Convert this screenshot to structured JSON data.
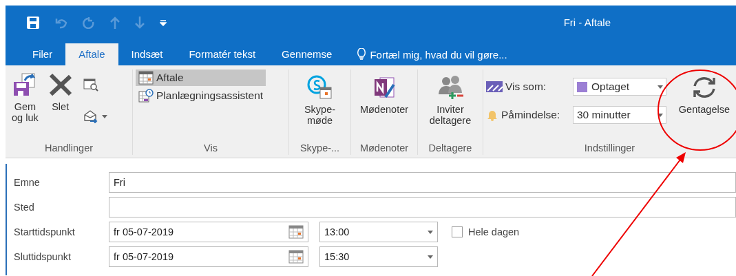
{
  "window": {
    "title": "Fri - Aftale"
  },
  "tabs": [
    {
      "label": "Filer",
      "selected": false
    },
    {
      "label": "Aftale",
      "selected": true
    },
    {
      "label": "Indsæt",
      "selected": false
    },
    {
      "label": "Formatér tekst",
      "selected": false
    },
    {
      "label": "Gennemse",
      "selected": false
    }
  ],
  "tell_me": {
    "placeholder": "Fortæl mig, hvad du vil gøre..."
  },
  "ribbon": {
    "groups": [
      {
        "label": "Handlinger",
        "kind": "actions",
        "buttons": [
          {
            "label": "Gem\nog luk",
            "kind": "save"
          },
          {
            "label": "Slet",
            "kind": "delete"
          }
        ]
      },
      {
        "label": "Vis",
        "kind": "views",
        "items": [
          {
            "label": "Aftale",
            "selected": true,
            "kind": "calendar"
          },
          {
            "label": "Planlægningsassistent",
            "selected": false,
            "kind": "scheduler"
          }
        ]
      },
      {
        "label": "Skype-...",
        "kind": "large",
        "buttons": [
          {
            "label": "Skype-\nmøde",
            "kind": "skype"
          }
        ]
      },
      {
        "label": "Mødenoter",
        "kind": "large",
        "buttons": [
          {
            "label": "Mødenoter",
            "kind": "notes"
          }
        ]
      },
      {
        "label": "Deltagere",
        "kind": "large",
        "buttons": [
          {
            "label": "Inviter\ndeltagere",
            "kind": "people"
          }
        ]
      },
      {
        "label": "Indstillinger",
        "kind": "options",
        "show_as": {
          "label": "Vis som:",
          "value": "Optaget",
          "color": "#9b7fd4"
        },
        "reminder": {
          "label": "Påmindelse:",
          "value": "30 minutter"
        },
        "buttons": [
          {
            "label": "Gentagelse",
            "kind": "recur"
          }
        ]
      }
    ]
  },
  "form": {
    "subject": {
      "label": "Emne",
      "value": "Fri"
    },
    "location": {
      "label": "Sted"
    },
    "start": {
      "label": "Starttidspunkt",
      "date": "fr 05-07-2019",
      "time": "13:00"
    },
    "end": {
      "label": "Sluttidspunkt",
      "date": "fr 05-07-2019",
      "time": "15:30"
    },
    "all_day": {
      "label": "Hele dagen",
      "checked": false
    }
  }
}
